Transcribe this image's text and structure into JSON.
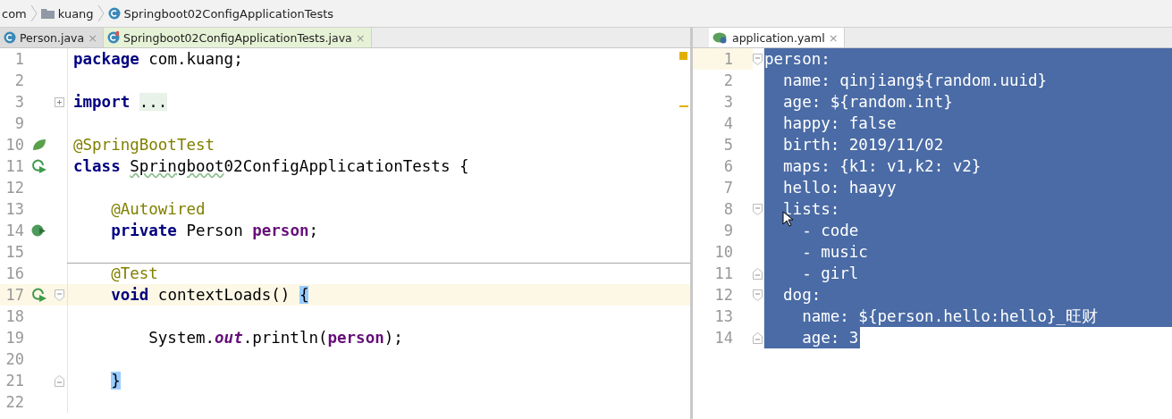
{
  "breadcrumb": [
    {
      "kind": "package",
      "label": "com"
    },
    {
      "kind": "folder",
      "label": "kuang"
    },
    {
      "kind": "class",
      "label": "Springboot02ConfigApplicationTests"
    }
  ],
  "left_editor": {
    "tabs": [
      {
        "label": "Person.java",
        "selected": false,
        "close": "×"
      },
      {
        "label": "Springboot02ConfigApplicationTests.java",
        "selected": true,
        "close": "×"
      }
    ],
    "lines": [
      {
        "number": "1",
        "tokens": [
          {
            "kind": "keyword",
            "text": "package"
          },
          {
            "kind": "plain",
            "text": " com.kuang;"
          }
        ]
      },
      {
        "number": "2"
      },
      {
        "number": "3",
        "fold": {
          "kind": "collapsed"
        },
        "tokens": [
          {
            "kind": "keyword",
            "text": "import "
          },
          {
            "kind": "folded",
            "text": "..."
          }
        ]
      },
      {
        "number": "9"
      },
      {
        "number": "10",
        "gutter": {
          "kind": "leaf"
        },
        "tokens": [
          {
            "kind": "annotation",
            "text": "@SpringBootTest"
          }
        ]
      },
      {
        "number": "11",
        "gutter": {
          "kind": "run"
        },
        "tokens": [
          {
            "kind": "keyword",
            "text": "class "
          },
          {
            "kind": "typo",
            "text": "Springboot"
          },
          {
            "kind": "plain",
            "text": "02ConfigApplicationTests {"
          }
        ]
      },
      {
        "number": "12"
      },
      {
        "number": "13",
        "tokens": [
          {
            "kind": "annotation",
            "text": "    @Autowired"
          }
        ]
      },
      {
        "number": "14",
        "gutter": {
          "kind": "bean"
        },
        "tokens": [
          {
            "kind": "keyword",
            "text": "    private"
          },
          {
            "kind": "plain",
            "text": " Person "
          },
          {
            "kind": "field",
            "text": "person"
          },
          {
            "kind": "plain",
            "text": ";"
          }
        ]
      },
      {
        "number": "15"
      },
      {
        "number": "16",
        "separator": true,
        "tokens": [
          {
            "kind": "annotation",
            "text": "    @Test"
          }
        ]
      },
      {
        "number": "17",
        "gutter": {
          "kind": "run"
        },
        "fold": {
          "kind": "start"
        },
        "current": true,
        "tokens": [
          {
            "kind": "keyword",
            "text": "    void"
          },
          {
            "kind": "plain",
            "text": " contextLoads() "
          },
          {
            "kind": "match",
            "text": "{"
          }
        ]
      },
      {
        "number": "18"
      },
      {
        "number": "19",
        "tokens": [
          {
            "kind": "plain",
            "text": "        System."
          },
          {
            "kind": "static",
            "text": "out"
          },
          {
            "kind": "plain",
            "text": ".println("
          },
          {
            "kind": "field",
            "text": "person"
          },
          {
            "kind": "plain",
            "text": ");"
          }
        ]
      },
      {
        "number": "20"
      },
      {
        "number": "21",
        "fold": {
          "kind": "end"
        },
        "tokens": [
          {
            "kind": "match",
            "text": "    }"
          }
        ]
      },
      {
        "number": "22"
      }
    ]
  },
  "right_editor": {
    "tabs": [
      {
        "label": "application.yaml",
        "selected": true,
        "close": "×"
      }
    ],
    "lines": [
      {
        "number": "1",
        "current": true,
        "fold": {
          "kind": "start"
        },
        "selected": true,
        "selection_to_end": true,
        "text": "person:"
      },
      {
        "number": "2",
        "selected": true,
        "selection_to_end": true,
        "text": "  name: qinjiang${random.uuid}"
      },
      {
        "number": "3",
        "selected": true,
        "selection_to_end": true,
        "text": "  age: ${random.int}"
      },
      {
        "number": "4",
        "selected": true,
        "selection_to_end": true,
        "text": "  happy: false"
      },
      {
        "number": "5",
        "selected": true,
        "selection_to_end": true,
        "text": "  birth: 2019/11/02"
      },
      {
        "number": "6",
        "selected": true,
        "selection_to_end": true,
        "text": "  maps: {k1: v1,k2: v2}"
      },
      {
        "number": "7",
        "selected": true,
        "selection_to_end": true,
        "text": "  hello: haayy"
      },
      {
        "number": "8",
        "fold": {
          "kind": "start"
        },
        "selected": true,
        "selection_to_end": true,
        "text": "  lists:"
      },
      {
        "number": "9",
        "selected": true,
        "selection_to_end": true,
        "text": "    - code"
      },
      {
        "number": "10",
        "selected": true,
        "selection_to_end": true,
        "text": "    - music"
      },
      {
        "number": "11",
        "fold": {
          "kind": "end"
        },
        "selected": true,
        "selection_to_end": true,
        "text": "    - girl"
      },
      {
        "number": "12",
        "fold": {
          "kind": "start"
        },
        "selected": true,
        "selection_to_end": true,
        "text": "  dog:"
      },
      {
        "number": "13",
        "selected": true,
        "selection_to_end": true,
        "text": "    name: ${person.hello:hello}_旺财"
      },
      {
        "number": "14",
        "fold": {
          "kind": "end"
        },
        "selected": true,
        "selection_to_end": false,
        "text": "    age: 3"
      }
    ]
  }
}
